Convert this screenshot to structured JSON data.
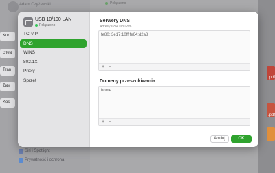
{
  "background": {
    "user_name": "Adam Czyżewski",
    "connected_label": "Połączono",
    "left_fragments": [
      "Kur",
      "chea",
      "Tran",
      "Zas",
      "Kos"
    ],
    "right_fragments": [
      ".pdf",
      ".pdf"
    ],
    "sidebar_items": [
      "Siri i Spotlight",
      "Prywatność i ochrona"
    ]
  },
  "dialog": {
    "interface": {
      "name": "USB 10/100 LAN",
      "status": "Połączono",
      "status_color": "#34c759"
    },
    "nav": {
      "items": [
        "TCP/IP",
        "DNS",
        "WINS",
        "802.1X",
        "Proxy",
        "Sprzęt"
      ],
      "active_index": 1,
      "accent": "#2fa32e"
    },
    "dns_servers": {
      "title": "Serwery DNS",
      "subtitle": "Adresy IPv4 lub IPv6",
      "entries": [
        "fe80::3e17:10ff:fe64:d2a8"
      ],
      "add_label": "+",
      "remove_label": "−"
    },
    "search_domains": {
      "title": "Domeny przeszukiwania",
      "entries": [
        "home"
      ],
      "add_label": "+",
      "remove_label": "−"
    },
    "footer": {
      "cancel_label": "Anuluj",
      "ok_label": "OK"
    }
  }
}
